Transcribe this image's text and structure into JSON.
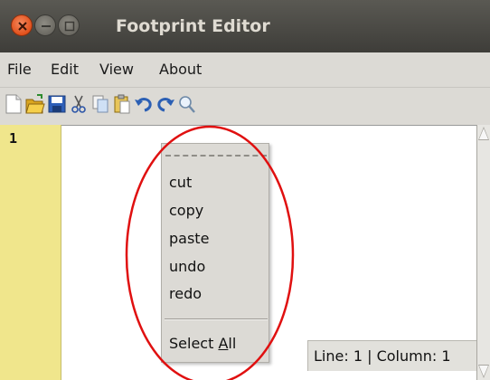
{
  "window": {
    "title": "Footprint Editor"
  },
  "menubar": {
    "items": [
      "File",
      "Edit",
      "View",
      "About"
    ]
  },
  "toolbar": {
    "icons": [
      "new-file-icon",
      "open-folder-icon",
      "save-icon",
      "cut-icon",
      "copy-icon",
      "paste-icon",
      "undo-icon",
      "redo-icon",
      "search-icon"
    ]
  },
  "editor": {
    "line_numbers": [
      "1"
    ]
  },
  "status": {
    "text": "Line: 1 | Column: 1"
  },
  "context_menu": {
    "items": [
      "cut",
      "copy",
      "paste",
      "undo",
      "redo"
    ],
    "select_all_prefix": "Select ",
    "select_all_accel": "A",
    "select_all_suffix": "ll"
  },
  "colors": {
    "titlebar": "#3e3d39",
    "close_button": "#e1501b",
    "gutter": "#f0e68c",
    "annotation": "#e01010"
  }
}
